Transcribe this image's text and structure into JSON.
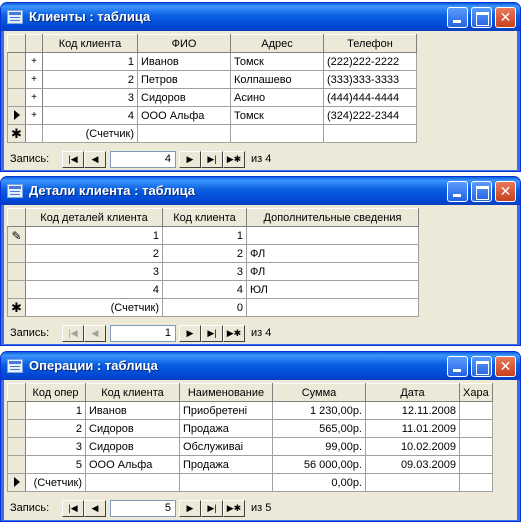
{
  "windows": [
    {
      "title": "Клиенты : таблица",
      "columns": [
        "Код клиента",
        "ФИО",
        "Адрес",
        "Телефон"
      ],
      "rows": [
        [
          "1",
          "Иванов",
          "Томск",
          "(222)222-2222"
        ],
        [
          "2",
          "Петров",
          "Колпашево",
          "(333)333-3333"
        ],
        [
          "3",
          "Сидоров",
          "Асино",
          "(444)444-4444"
        ],
        [
          "4",
          "ООО Альфа",
          "Томск",
          "(324)222-2344"
        ]
      ],
      "new_row": [
        "(Счетчик)",
        "",
        "",
        ""
      ],
      "nav": {
        "label": "Запись:",
        "current": "4",
        "of_text": "из 4"
      }
    },
    {
      "title": "Детали клиента : таблица",
      "columns": [
        "Код деталей клиента",
        "Код клиента",
        "Дополнительные сведения"
      ],
      "rows": [
        [
          "1",
          "1",
          ""
        ],
        [
          "2",
          "2",
          "ФЛ"
        ],
        [
          "3",
          "3",
          "ФЛ"
        ],
        [
          "4",
          "4",
          "ЮЛ"
        ]
      ],
      "new_row": [
        "(Счетчик)",
        "0",
        ""
      ],
      "nav": {
        "label": "Запись:",
        "current": "1",
        "of_text": "из 4"
      }
    },
    {
      "title": "Операции : таблица",
      "columns": [
        "Код опер",
        "Код клиента",
        "Наименование",
        "Сумма",
        "Дата",
        "Хара"
      ],
      "rows": [
        [
          "1",
          "Иванов",
          "Приобретені",
          "1 230,00р.",
          "12.11.2008",
          ""
        ],
        [
          "2",
          "Сидоров",
          "Продажа",
          "565,00р.",
          "11.01.2009",
          ""
        ],
        [
          "3",
          "Сидоров",
          "Обслуживаі",
          "99,00р.",
          "10.02.2009",
          ""
        ],
        [
          "5",
          "ООО Альфа",
          "Продажа",
          "56 000,00р.",
          "09.03.2009",
          ""
        ]
      ],
      "new_row": [
        "(Счетчик)",
        "",
        "",
        "0,00р.",
        "",
        ""
      ],
      "nav": {
        "label": "Запись:",
        "current": "5",
        "of_text": "из 5"
      }
    }
  ]
}
